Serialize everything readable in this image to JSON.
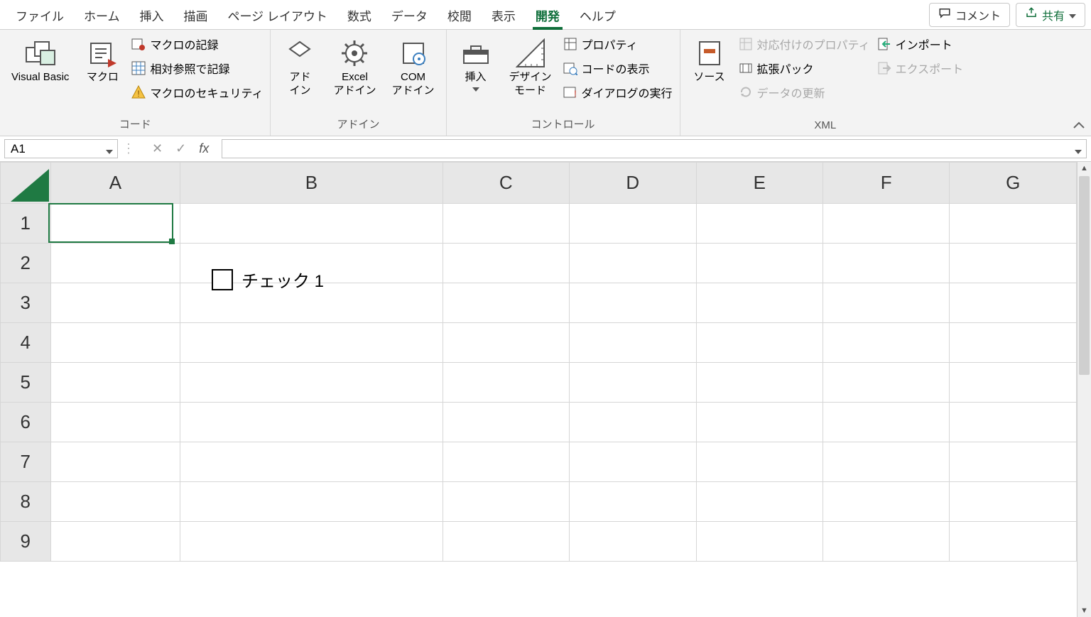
{
  "tabs": {
    "file": "ファイル",
    "home": "ホーム",
    "insert": "挿入",
    "draw": "描画",
    "pagelayout": "ページ レイアウト",
    "formulas": "数式",
    "data": "データ",
    "review": "校閲",
    "view": "表示",
    "developer": "開発",
    "help": "ヘルプ",
    "active": "developer",
    "comments": "コメント",
    "share": "共有"
  },
  "ribbon": {
    "code": {
      "vb": "Visual Basic",
      "macros": "マクロ",
      "record": "マクロの記録",
      "relative": "相対参照で記録",
      "security": "マクロのセキュリティ",
      "group": "コード"
    },
    "addins": {
      "addin": "アド\nイン",
      "excelAddin": "Excel\nアドイン",
      "comAddin": "COM\nアドイン",
      "group": "アドイン"
    },
    "controls": {
      "insert": "挿入",
      "design": "デザイン\nモード",
      "properties": "プロパティ",
      "viewcode": "コードの表示",
      "rundialog": "ダイアログの実行",
      "group": "コントロール"
    },
    "xml": {
      "source": "ソース",
      "mapProps": "対応付けのプロパティ",
      "expansion": "拡張パック",
      "refresh": "データの更新",
      "import": "インポート",
      "export": "エクスポート",
      "group": "XML"
    }
  },
  "formulaBar": {
    "nameBox": "A1",
    "cancel": "✕",
    "enter": "✓",
    "fx": "fx",
    "formula": ""
  },
  "grid": {
    "cols": [
      "A",
      "B",
      "C",
      "D",
      "E",
      "F",
      "G"
    ],
    "rows": [
      "1",
      "2",
      "3",
      "4",
      "5",
      "6",
      "7",
      "8",
      "9"
    ],
    "selected": "A1",
    "checkbox": {
      "label": "チェック 1"
    }
  }
}
